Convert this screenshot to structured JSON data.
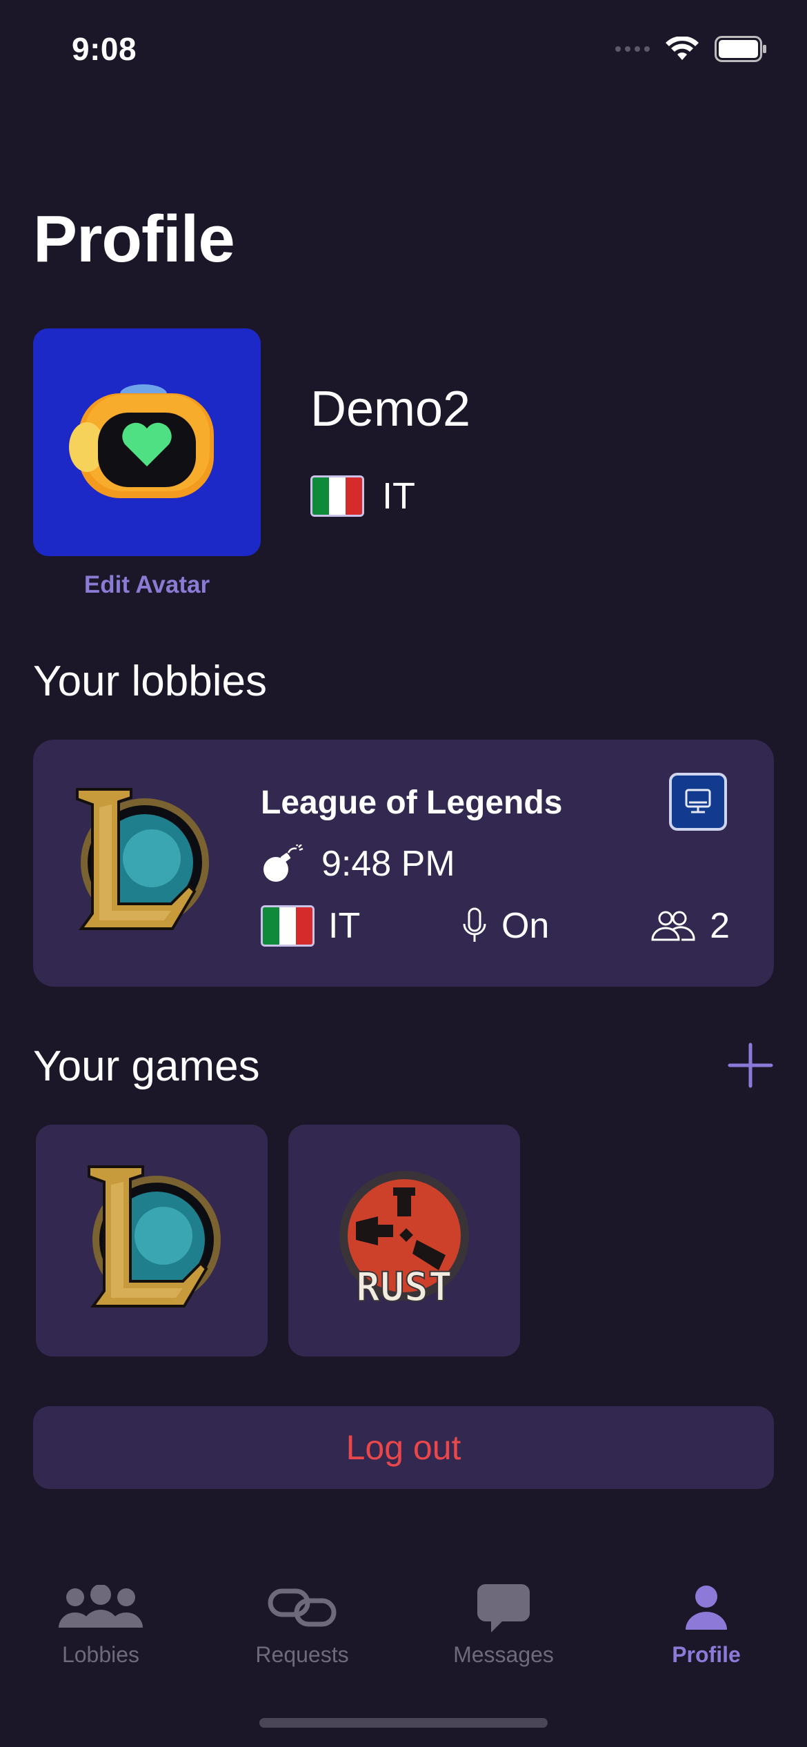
{
  "status_bar": {
    "time": "9:08"
  },
  "header": {
    "title": "Profile"
  },
  "profile": {
    "username": "Demo2",
    "country_code": "IT",
    "edit_avatar_label": "Edit Avatar",
    "avatar_icon": "mascot-avatar-icon"
  },
  "lobbies": {
    "section_title": "Your lobbies",
    "items": [
      {
        "game": "League of Legends",
        "time": "9:48 PM",
        "country_code": "IT",
        "mic": "On",
        "players": "2",
        "platform_icon": "pc-icon"
      }
    ]
  },
  "games": {
    "section_title": "Your games",
    "items": [
      {
        "name": "League of Legends",
        "icon": "league-of-legends-logo"
      },
      {
        "name": "Rust",
        "icon": "rust-logo",
        "logo_text": "RUST"
      }
    ]
  },
  "logout": {
    "label": "Log out"
  },
  "tabs": [
    {
      "label": "Lobbies",
      "icon": "group-icon",
      "active": false
    },
    {
      "label": "Requests",
      "icon": "link-icon",
      "active": false
    },
    {
      "label": "Messages",
      "icon": "chat-bubble-icon",
      "active": false
    },
    {
      "label": "Profile",
      "icon": "person-icon",
      "active": true
    }
  ],
  "colors": {
    "background": "#1b1729",
    "card": "#322850",
    "accent": "#8d7ad8",
    "danger": "#e9474a",
    "avatar_bg": "#1c29c7"
  }
}
